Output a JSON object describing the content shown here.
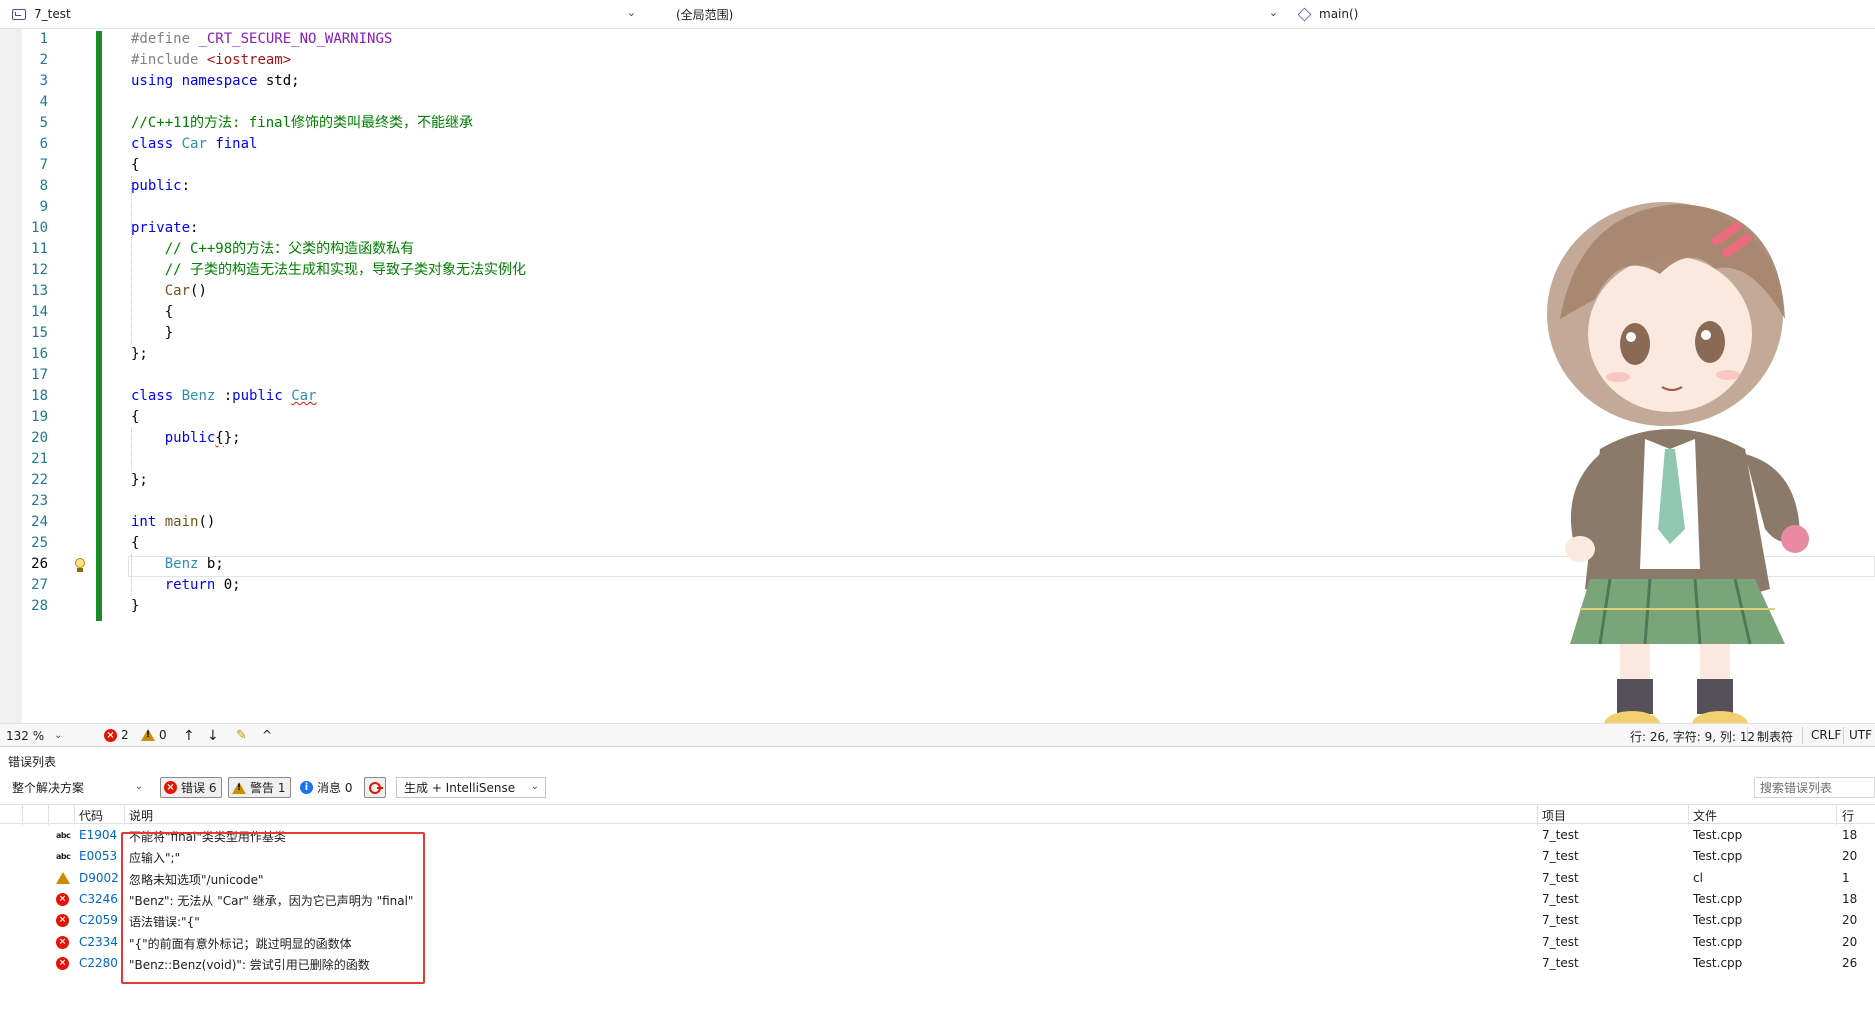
{
  "navbar": {
    "project": "7_test",
    "scope": "(全局范围)",
    "function": "main()"
  },
  "editor": {
    "line_numbers": [
      "1",
      "2",
      "3",
      "4",
      "5",
      "6",
      "7",
      "8",
      "9",
      "10",
      "11",
      "12",
      "13",
      "14",
      "15",
      "16",
      "17",
      "18",
      "19",
      "20",
      "21",
      "22",
      "23",
      "24",
      "25",
      "26",
      "27",
      "28"
    ],
    "current_line": 26
  },
  "statusbar": {
    "zoom": "132 %",
    "error_count": "2",
    "warning_count": "0",
    "position": "行: 26, 字符: 9, 列: 12",
    "indent": "制表符",
    "line_ending": "CRLF",
    "encoding": "UTF"
  },
  "error_list": {
    "title": "错误列表",
    "scope": "整个解决方案",
    "errors_filter": "错误 6",
    "warnings_filter": "警告 1",
    "messages_filter": "消息 0",
    "build_filter": "生成 + IntelliSense",
    "search_placeholder": "搜索错误列表",
    "headers": {
      "code": "代码",
      "description": "说明",
      "project": "项目",
      "file": "文件",
      "line": "行"
    },
    "rows": [
      {
        "icon": "abc-icon",
        "code": "E1904",
        "description": "不能将\"final\"类类型用作基类",
        "project": "7_test",
        "file": "Test.cpp",
        "line": "18"
      },
      {
        "icon": "abc-icon",
        "code": "E0053",
        "description": "应输入\";\"",
        "project": "7_test",
        "file": "Test.cpp",
        "line": "20"
      },
      {
        "icon": "warning-icon",
        "code": "D9002",
        "description": "忽略未知选项\"/unicode\"",
        "project": "7_test",
        "file": "cl",
        "line": "1"
      },
      {
        "icon": "error-icon",
        "code": "C3246",
        "description": "\"Benz\": 无法从 \"Car\" 继承，因为它已声明为 \"final\"",
        "project": "7_test",
        "file": "Test.cpp",
        "line": "18"
      },
      {
        "icon": "error-icon",
        "code": "C2059",
        "description": "语法错误:\"{\"",
        "project": "7_test",
        "file": "Test.cpp",
        "line": "20"
      },
      {
        "icon": "error-icon",
        "code": "C2334",
        "description": "\"{\"的前面有意外标记；跳过明显的函数体",
        "project": "7_test",
        "file": "Test.cpp",
        "line": "20"
      },
      {
        "icon": "error-icon",
        "code": "C2280",
        "description": "\"Benz::Benz(void)\": 尝试引用已删除的函数",
        "project": "7_test",
        "file": "Test.cpp",
        "line": "26"
      }
    ]
  },
  "colors": {
    "accent_purple": "#6b3fa0",
    "change_bar": "#1b8b2b",
    "error": "#e51400",
    "warning": "#c98e00",
    "highlight_box": "#e53935"
  }
}
